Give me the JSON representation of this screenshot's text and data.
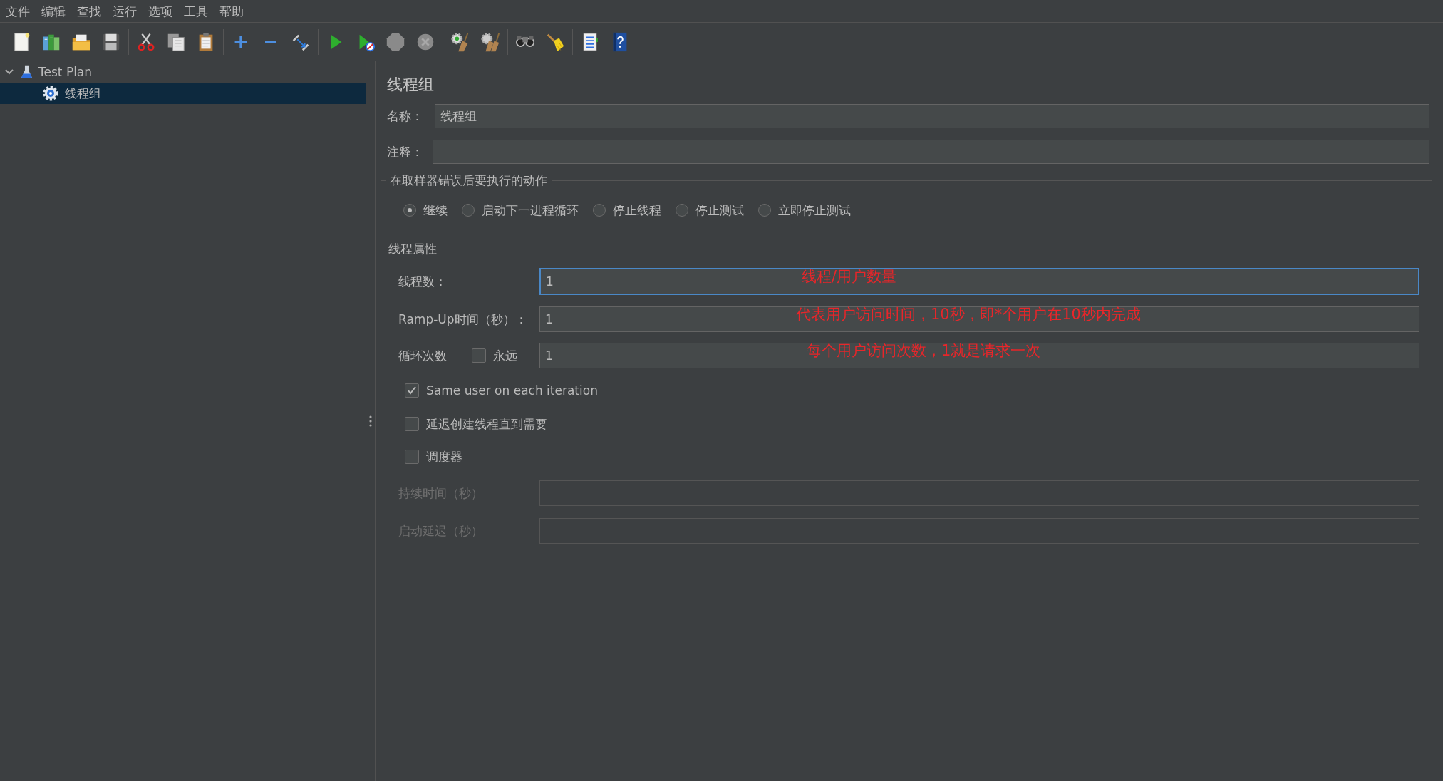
{
  "menu_bar": [
    {
      "label": "文件"
    },
    {
      "label": "编辑"
    },
    {
      "label": "查找"
    },
    {
      "label": "运行"
    },
    {
      "label": "选项"
    },
    {
      "label": "工具"
    },
    {
      "label": "帮助"
    }
  ],
  "tree": [
    {
      "label": "Test Plan",
      "kind": "plan",
      "expanded": true,
      "selected": false,
      "children": [
        {
          "label": "线程组",
          "kind": "thread_group",
          "selected": true
        }
      ]
    }
  ],
  "editor": {
    "title": "线程组",
    "name_field": {
      "label": "名称：",
      "value": "线程组"
    },
    "comment_field": {
      "label": "注释："
    },
    "error_action": {
      "title": "在取样器错误后要执行的动作",
      "options": [
        {
          "label": "继续",
          "selected": true
        },
        {
          "label": "启动下一进程循环",
          "selected": false
        },
        {
          "label": "停止线程",
          "selected": false
        },
        {
          "label": "停止测试",
          "selected": false
        },
        {
          "label": "立即停止测试",
          "selected": false
        }
      ]
    },
    "thread_properties": {
      "title": "线程属性",
      "rows": [
        {
          "kind": "field",
          "label": "线程数：",
          "value": "1",
          "focused": true,
          "annotation": "线程/用户数量"
        },
        {
          "kind": "field",
          "label": "Ramp-Up时间（秒）：",
          "value": "1",
          "focused": false,
          "annotation": "代表用户访问时间，10秒，即*个用户在10秒内完成"
        },
        {
          "kind": "loop",
          "label": "循环次数",
          "forever": {
            "label": "永远",
            "checked": false
          },
          "value": "1",
          "focused": false,
          "annotation": "每个用户访问次数，1就是请求一次"
        }
      ],
      "options": [
        {
          "label": "Same user on each iteration",
          "checked": true
        },
        {
          "label": "延迟创建线程直到需要",
          "checked": false
        },
        {
          "label": "调度器",
          "checked": false
        }
      ],
      "scheduler_fields": [
        {
          "label": "持续时间（秒）",
          "disabled": true
        },
        {
          "label": "启动延迟（秒）",
          "disabled": true
        }
      ]
    }
  }
}
